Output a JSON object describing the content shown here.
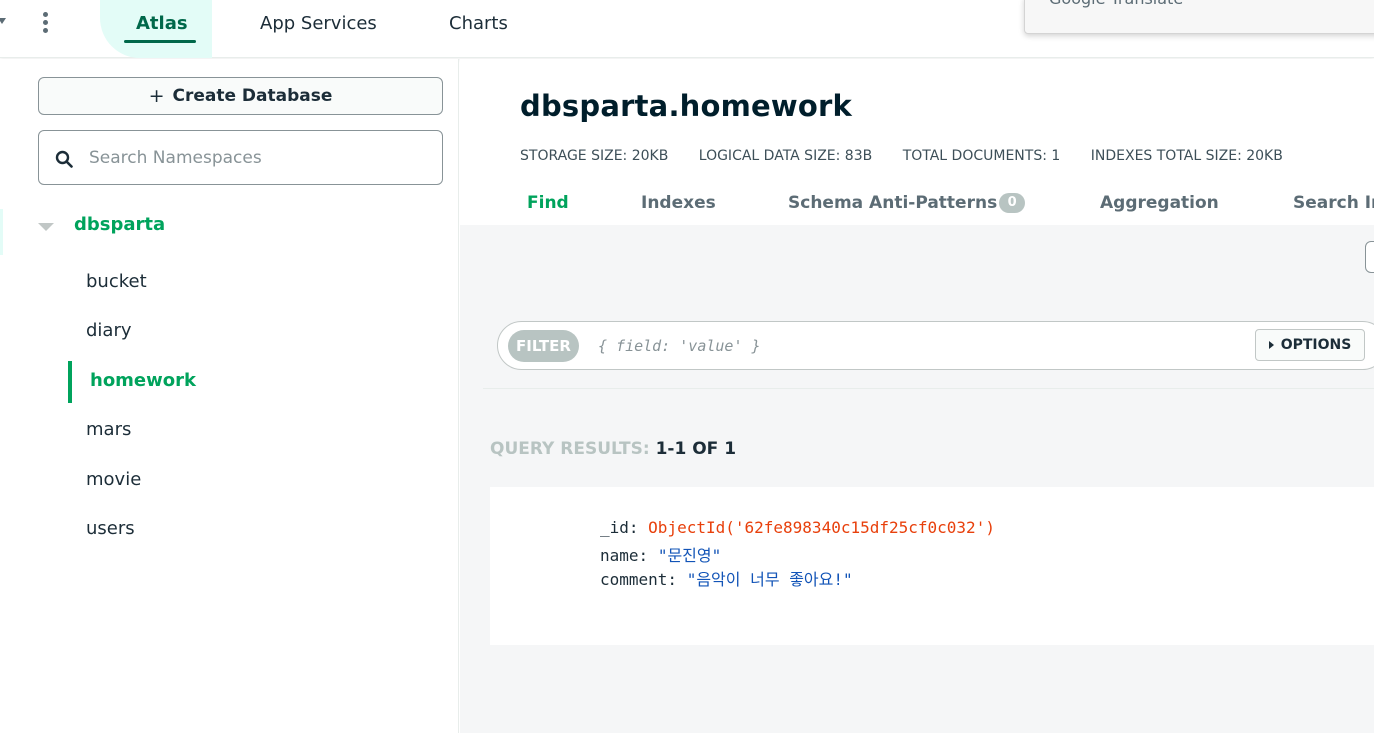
{
  "nav": {
    "tabs": [
      "Atlas",
      "App Services",
      "Charts"
    ],
    "popup_text": "Google Translate"
  },
  "sidebar": {
    "create_button": "Create Database",
    "create_icon": "+",
    "search_placeholder": "Search Namespaces",
    "database": "dbsparta",
    "collections": [
      "bucket",
      "diary",
      "homework",
      "mars",
      "movie",
      "users"
    ],
    "active_collection": "homework"
  },
  "main": {
    "title": "dbsparta.homework",
    "stats": {
      "storage_size": "STORAGE SIZE: 20KB",
      "logical_size": "LOGICAL DATA SIZE: 83B",
      "total_documents": "TOTAL DOCUMENTS: 1",
      "indexes_size": "INDEXES TOTAL SIZE: 20KB"
    },
    "tabs": {
      "find": "Find",
      "indexes": "Indexes",
      "schema": "Schema Anti-Patterns",
      "schema_count": "0",
      "aggregation": "Aggregation",
      "search": "Search In"
    },
    "filter": {
      "label": "FILTER",
      "placeholder": "{ field: 'value' }",
      "options_label": "OPTIONS"
    },
    "query_results": {
      "label": "QUERY RESULTS:",
      "range": "1-1 OF 1"
    },
    "document": {
      "id_key": "_id:",
      "id_value": "ObjectId('62fe898340c15df25cf0c032')",
      "name_key": "name:",
      "name_value": "\"문진영\"",
      "comment_key": "comment:",
      "comment_value": "\"음악이 너무 좋아요!\""
    }
  },
  "colors": {
    "brand_green": "#00a35c",
    "dark_green": "#00684a",
    "object_id": "#e8400c",
    "string_value": "#1254b7"
  }
}
